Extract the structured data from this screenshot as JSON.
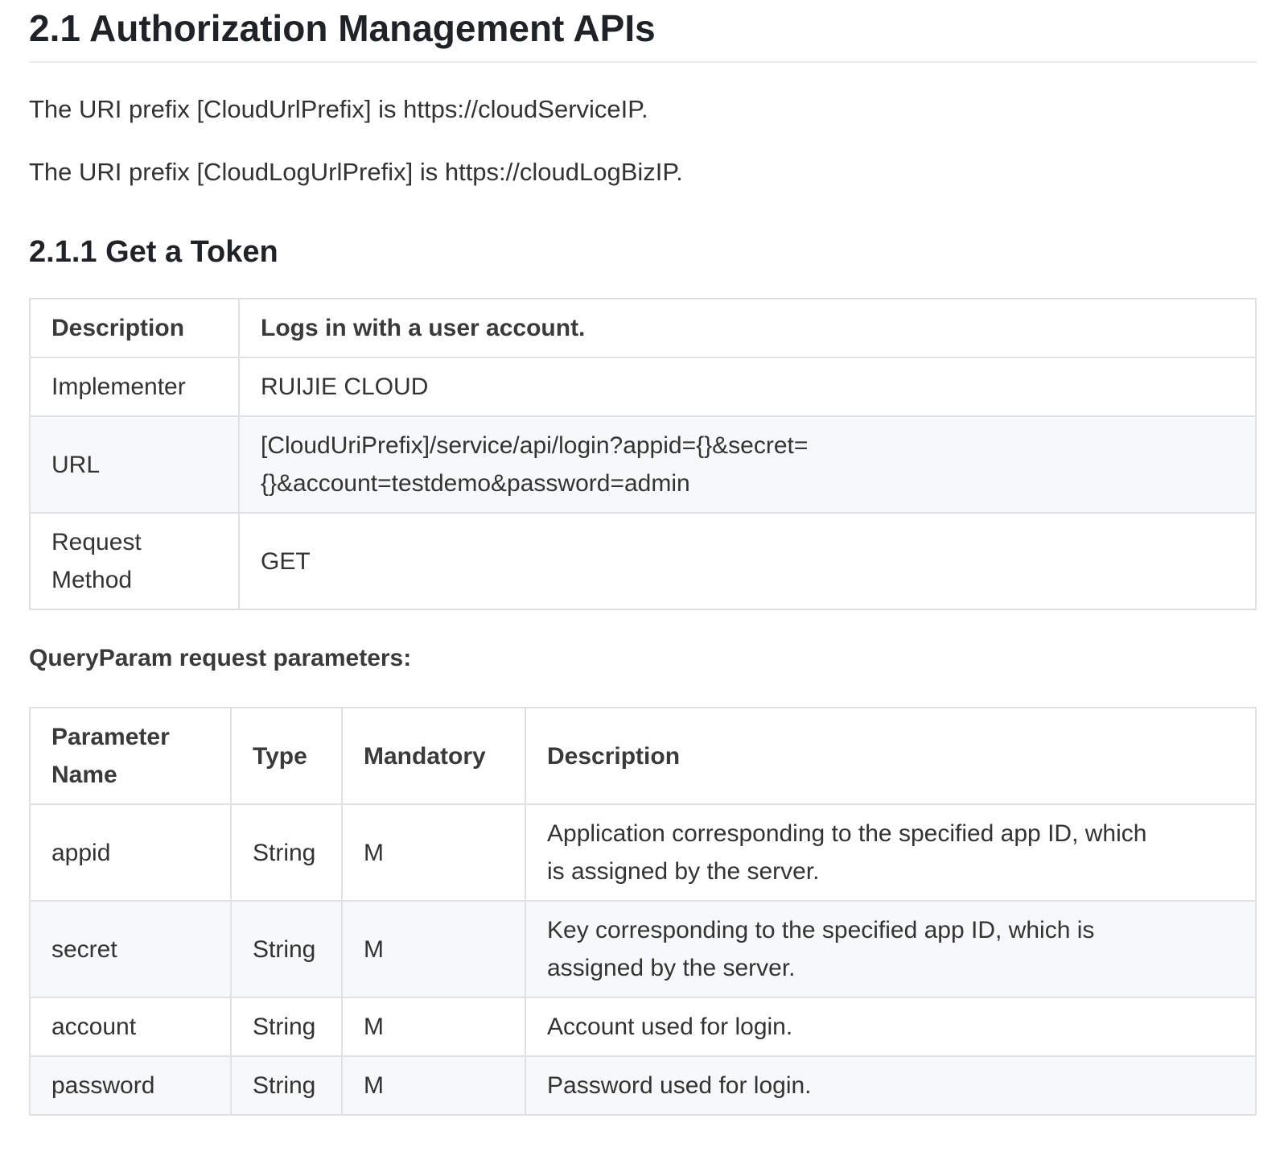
{
  "heading": "2.1 Authorization Management APIs",
  "prefix_lines": [
    "The URI prefix [CloudUrlPrefix] is https://cloudServiceIP.",
    "The URI prefix [CloudLogUrlPrefix] is https://cloudLogBizIP."
  ],
  "subheading": "2.1.1 Get a Token",
  "info_table": {
    "rows": [
      {
        "key": "Description",
        "value": "Logs in with a user account."
      },
      {
        "key": "Implementer",
        "value": "RUIJIE CLOUD"
      },
      {
        "key": "URL",
        "value_line1": "[CloudUriPrefix]/service/api/login?appid={}&secret=",
        "value_line2": "{}&account=testdemo&password=admin"
      },
      {
        "key_line1": "Request",
        "key_line2": "Method",
        "value": "GET"
      }
    ]
  },
  "params_label": "QueryParam request parameters:",
  "params_table": {
    "headers": {
      "name_line1": "Parameter",
      "name_line2": "Name",
      "type": "Type",
      "mandatory": "Mandatory",
      "description": "Description"
    },
    "rows": [
      {
        "name": "appid",
        "type": "String",
        "mandatory": "M",
        "desc_line1": "Application corresponding to the specified app ID, which",
        "desc_line2": "is assigned by the server."
      },
      {
        "name": "secret",
        "type": "String",
        "mandatory": "M",
        "desc_line1": "Key corresponding to the specified app ID, which is",
        "desc_line2": "assigned by the server."
      },
      {
        "name": "account",
        "type": "String",
        "mandatory": "M",
        "desc": "Account used for login."
      },
      {
        "name": "password",
        "type": "String",
        "mandatory": "M",
        "desc": "Password used for login."
      }
    ]
  }
}
